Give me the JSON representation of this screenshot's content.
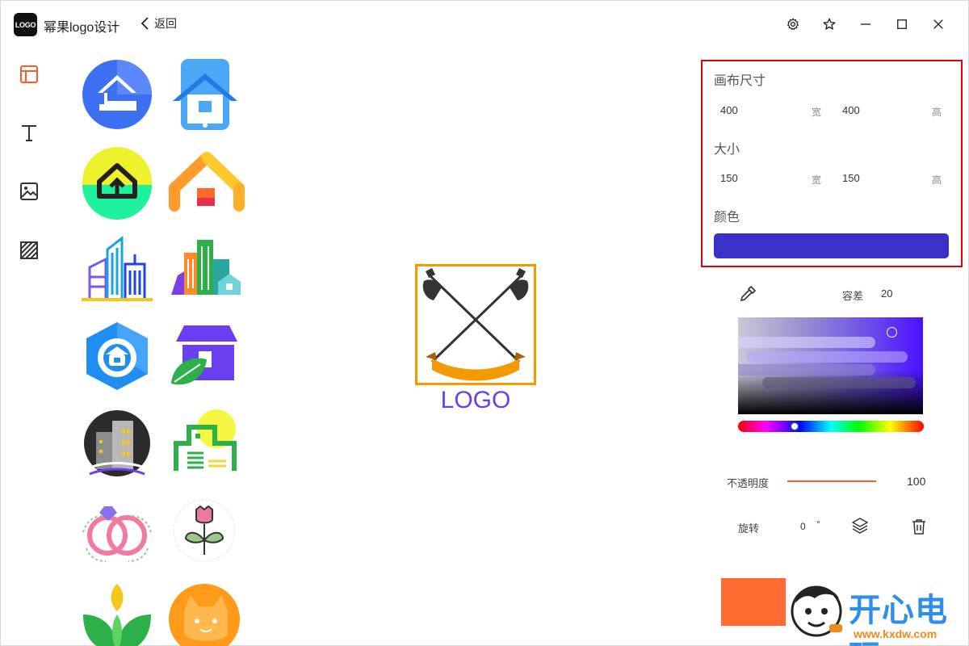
{
  "app": {
    "logo_badge": "LOGO",
    "name": "幂果logo设计",
    "back_label": "返回"
  },
  "sidebar": {
    "tools": [
      "layout-icon",
      "text-icon",
      "image-icon",
      "pattern-icon"
    ]
  },
  "templates": [
    "house-circle",
    "house-phone",
    "house-arrow",
    "house-roof",
    "city-buildings-blue",
    "city-buildings-color",
    "hexagon-house",
    "shop-leaf",
    "dark-circle-building",
    "green-building-sun",
    "wedding-rings",
    "rose-flower",
    "green-leaves",
    "orange-cat"
  ],
  "canvas": {
    "logo_text": "LOGO",
    "text_color": "#6a3ff0",
    "frame_color": "#f39a00"
  },
  "properties": {
    "canvas_size": {
      "title": "画布尺寸",
      "width": "400",
      "width_unit": "宽",
      "height": "400",
      "height_unit": "高"
    },
    "size": {
      "title": "大小",
      "width": "150",
      "width_unit": "宽",
      "height": "150",
      "height_unit": "高"
    },
    "color": {
      "title": "颜色",
      "value": "#3a31c8"
    },
    "highlight_color": "#e3000b"
  },
  "color_tools": {
    "tolerance_label": "容差",
    "tolerance_value": "20"
  },
  "opacity": {
    "label": "不透明度",
    "value": "100"
  },
  "rotation": {
    "label": "旋转",
    "value": "0",
    "unit": "°"
  },
  "watermark": {
    "text": "开心电玩",
    "url": "www.kxdw.com"
  },
  "colors": {
    "accent": "#ff6a33",
    "primary_selected": "#3a31c8"
  }
}
